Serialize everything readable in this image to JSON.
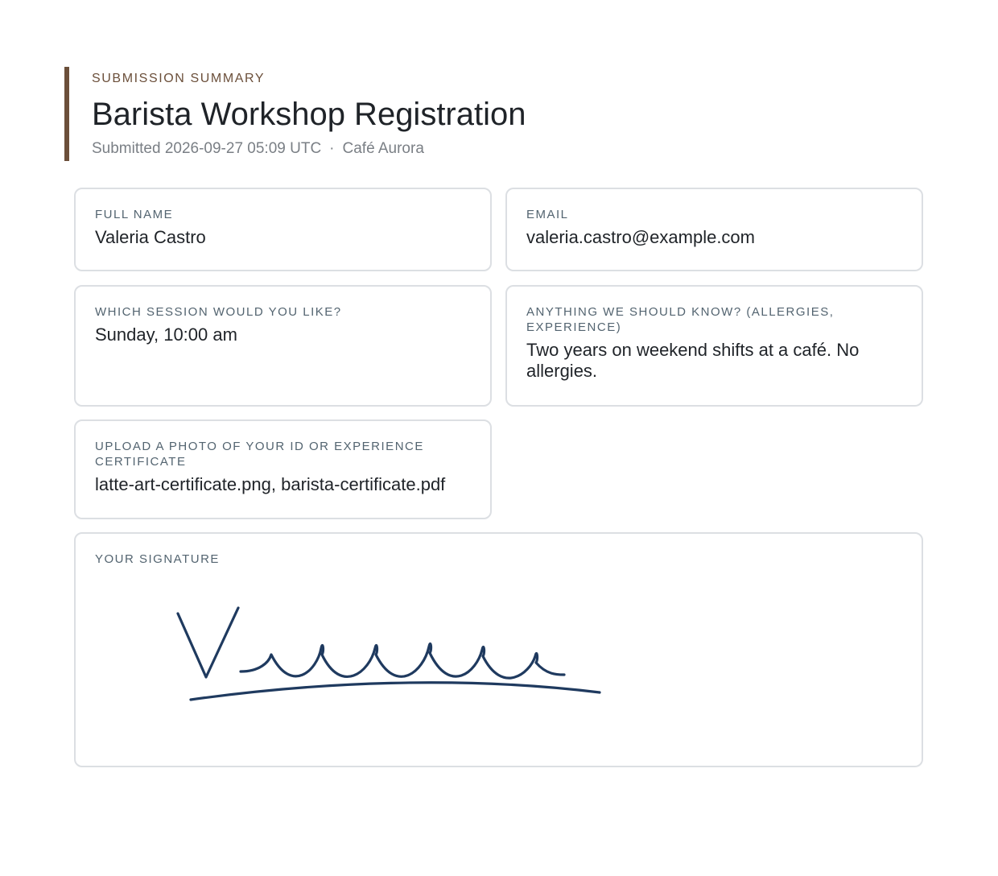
{
  "header": {
    "eyebrow": "SUBMISSION SUMMARY",
    "title": "Barista Workshop Registration",
    "submitted": "Submitted 2026-09-27 05:09 UTC",
    "separator": "·",
    "venue": "Café Aurora"
  },
  "fields": {
    "full_name": {
      "label": "FULL NAME",
      "value": "Valeria Castro"
    },
    "email": {
      "label": "EMAIL",
      "value": "valeria.castro@example.com"
    },
    "session": {
      "label": "WHICH SESSION WOULD YOU LIKE?",
      "value": "Sunday, 10:00 am"
    },
    "notes": {
      "label": "ANYTHING WE SHOULD KNOW? (ALLERGIES, EXPERIENCE)",
      "value": "Two years on weekend shifts at a café. No allergies."
    },
    "upload": {
      "label": "UPLOAD A PHOTO OF YOUR ID OR EXPERIENCE CERTIFICATE",
      "value": "latte-art-certificate.png, barista-certificate.pdf"
    },
    "signature": {
      "label": "YOUR SIGNATURE"
    }
  },
  "colors": {
    "accent": "#6b4f3a",
    "label": "#536470",
    "ink": "#1f3a5f",
    "border": "#dcdfe3"
  }
}
